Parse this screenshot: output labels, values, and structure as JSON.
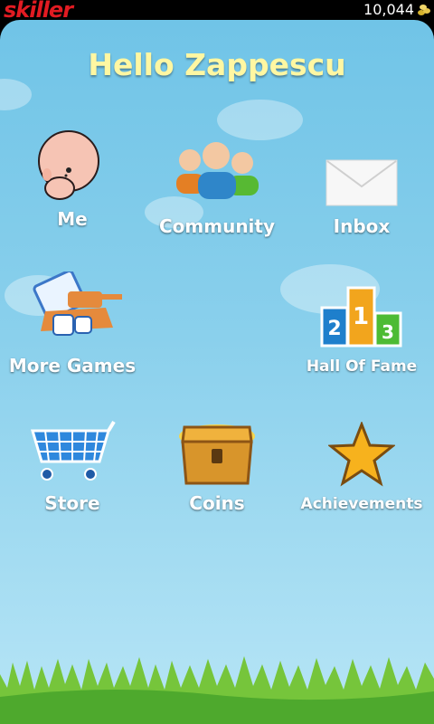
{
  "status_bar": {
    "brand": "skiller",
    "coin_balance": "10,044"
  },
  "header": {
    "greeting": "Hello Zappescu"
  },
  "menu": {
    "me": "Me",
    "community": "Community",
    "inbox": "Inbox",
    "more_games": "More Games",
    "hall_of_fame": "Hall Of Fame",
    "store": "Store",
    "coins": "Coins",
    "achievements": "Achievements"
  },
  "hall_of_fame_podium": [
    "2",
    "1",
    "3"
  ],
  "colors": {
    "accent": "#e21b22",
    "title": "#fff7a2",
    "sky": "#8ad0ec"
  }
}
